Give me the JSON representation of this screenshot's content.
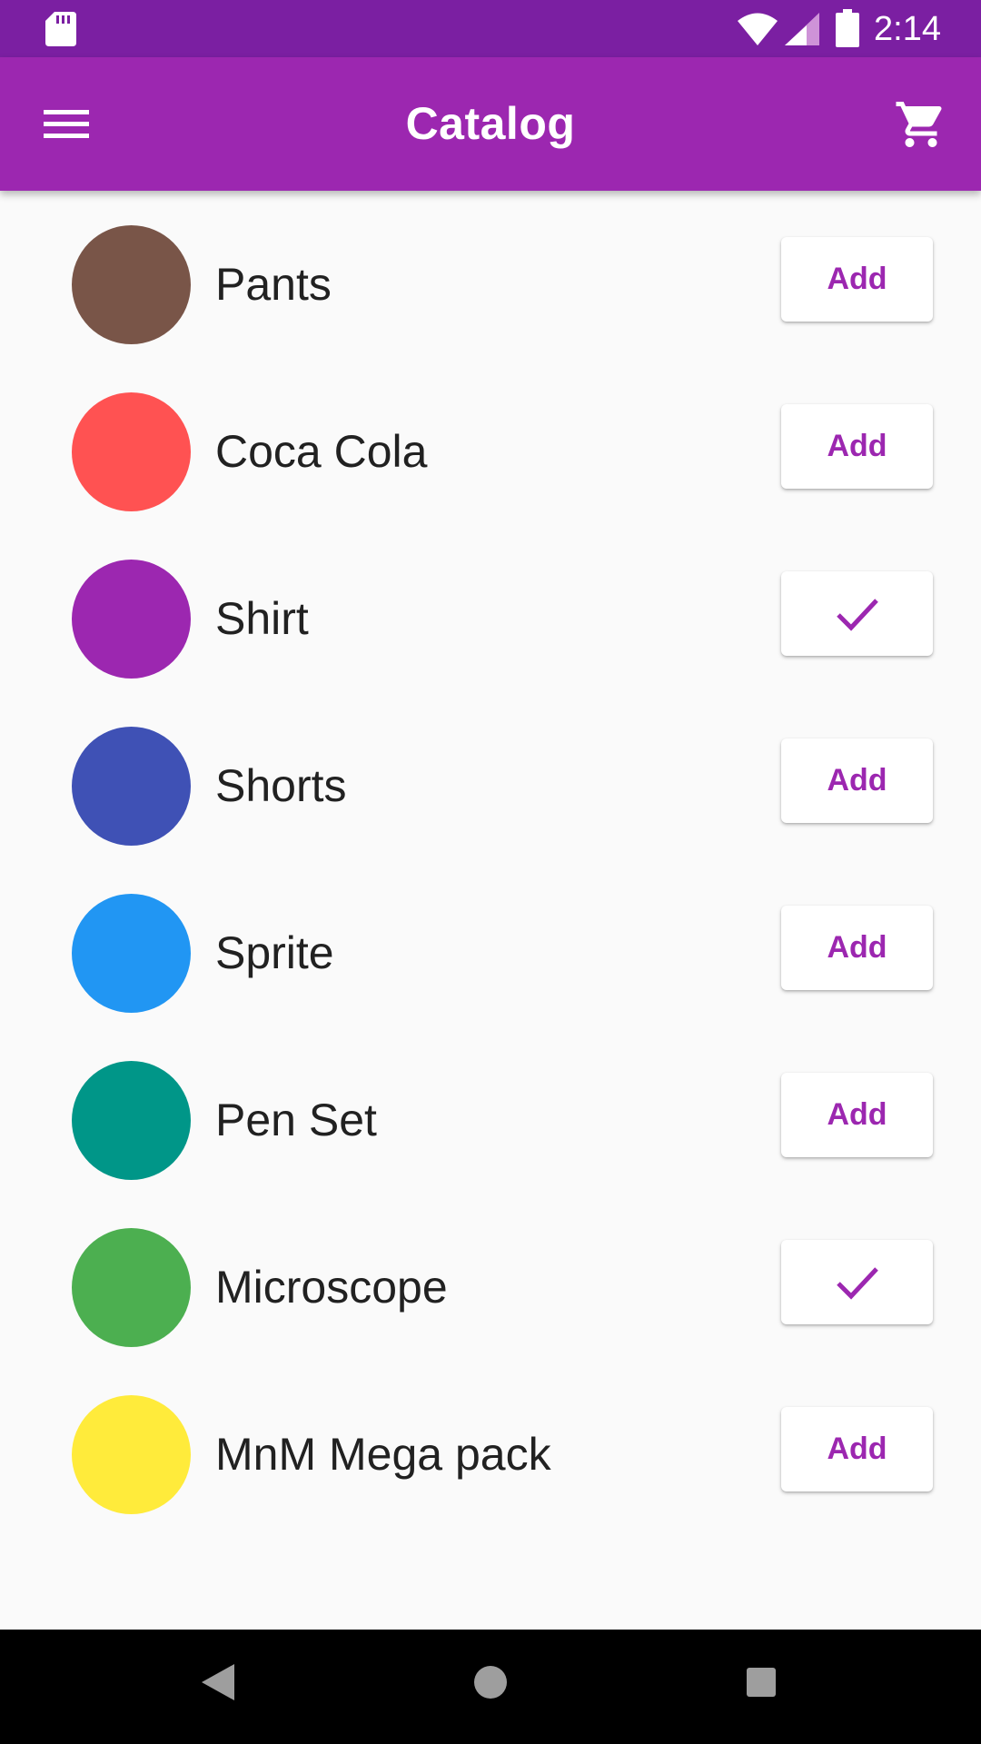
{
  "status_bar": {
    "time": "2:14",
    "icons": [
      "sd-card-icon",
      "wifi-icon",
      "signal-icon",
      "battery-icon"
    ],
    "background": "#7b1fa2"
  },
  "app_bar": {
    "title": "Catalog",
    "menu_icon": "menu-icon",
    "cart_icon": "shopping-cart-icon",
    "background": "#9c27b0"
  },
  "catalog": {
    "items": [
      {
        "name": "Pants",
        "color": "#795548",
        "action": "Add",
        "in_cart": false
      },
      {
        "name": "Coca Cola",
        "color": "#ff5252",
        "action": "Add",
        "in_cart": false
      },
      {
        "name": "Shirt",
        "color": "#9c27b0",
        "action": "",
        "in_cart": true
      },
      {
        "name": "Shorts",
        "color": "#3f51b5",
        "action": "Add",
        "in_cart": false
      },
      {
        "name": "Sprite",
        "color": "#2196f3",
        "action": "Add",
        "in_cart": false
      },
      {
        "name": "Pen Set",
        "color": "#009688",
        "action": "Add",
        "in_cart": false
      },
      {
        "name": "Microscope",
        "color": "#4caf50",
        "action": "",
        "in_cart": true
      },
      {
        "name": "MnM Mega pack",
        "color": "#ffeb3b",
        "action": "Add",
        "in_cart": false
      }
    ]
  },
  "nav_bar": {
    "icons": [
      "back-icon",
      "home-icon",
      "recents-icon"
    ]
  },
  "theme": {
    "accent": "#9c27b0",
    "background": "#fafafa",
    "text": "#212121"
  }
}
